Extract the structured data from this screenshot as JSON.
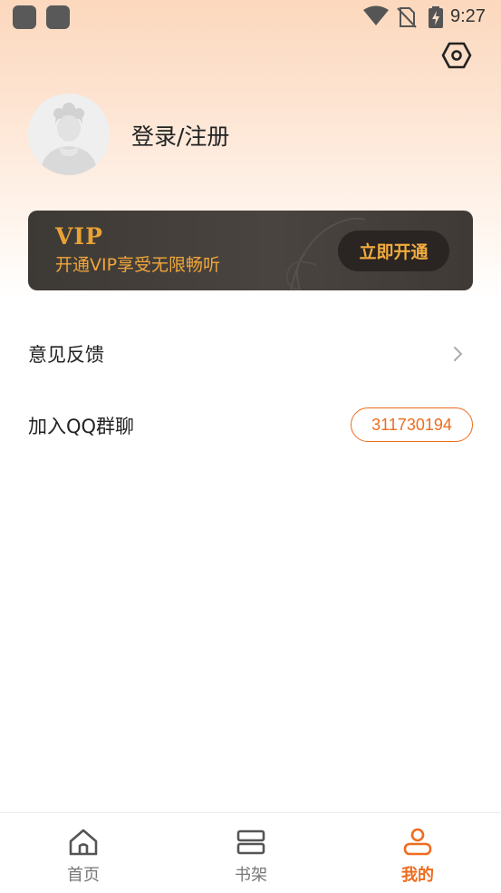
{
  "status_bar": {
    "time": "9:27",
    "icons": [
      "app-notification-icon",
      "app-notification-icon",
      "wifi-icon",
      "no-sim-icon",
      "battery-charging-icon"
    ]
  },
  "header": {
    "settings_icon": "settings-hexagon-icon"
  },
  "profile": {
    "avatar_icon": "default-avatar-icon",
    "login_label": "登录/注册"
  },
  "vip": {
    "title": "VIP",
    "subtitle": "开通VIP享受无限畅听",
    "button_label": "立即开通"
  },
  "menu": {
    "feedback_label": "意见反馈",
    "qq_label": "加入QQ群聊",
    "qq_number": "311730194"
  },
  "bottom_nav": {
    "items": [
      {
        "label": "首页",
        "icon": "home-icon"
      },
      {
        "label": "书架",
        "icon": "bookshelf-icon"
      },
      {
        "label": "我的",
        "icon": "profile-icon"
      }
    ],
    "active_index": 2
  },
  "colors": {
    "accent": "#ee6c1f",
    "vip_gold": "#f0a63a",
    "vip_bg": "#403b37",
    "header_gradient_top": "#fcd8bd"
  }
}
